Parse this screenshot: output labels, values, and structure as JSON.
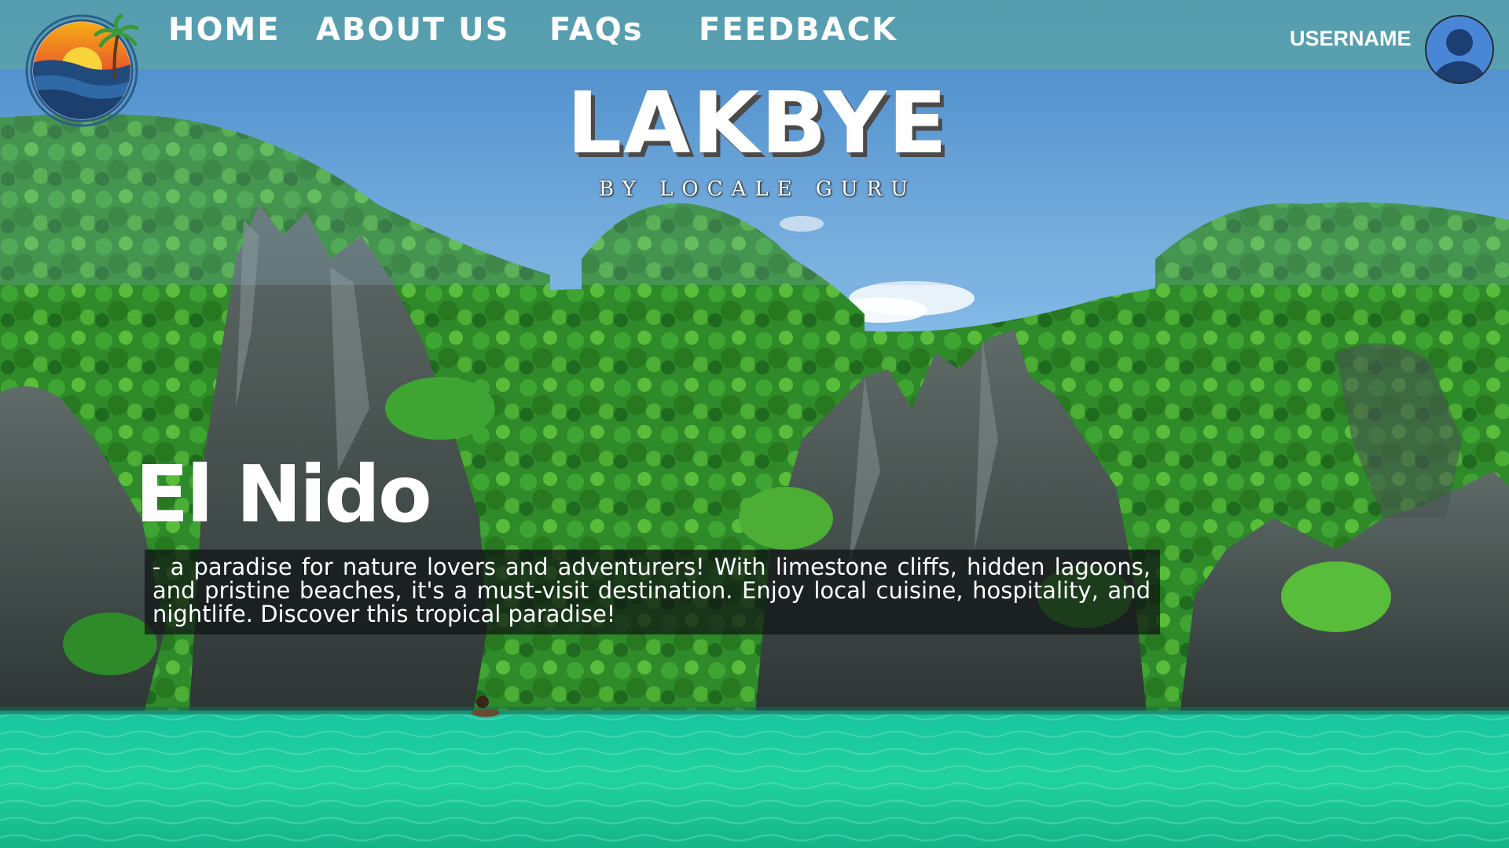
{
  "nav": {
    "items": [
      {
        "label": "HOME"
      },
      {
        "label": "ABOUT US"
      },
      {
        "label": "FAQs"
      },
      {
        "label": "FEEDBACK"
      }
    ]
  },
  "user": {
    "username": "USERNAME",
    "avatar_icon": "user-avatar-icon"
  },
  "brand": {
    "title": "LAKBYE",
    "subtitle": "BY LOCALE GURU",
    "logo_icon": "sunset-island-logo-icon"
  },
  "destination": {
    "name": "El Nido",
    "description": "- a paradise for nature lovers and adventurers! With limestone cliffs, hidden lagoons, and pristine beaches, it's a must-visit destination. Enjoy local cuisine, hospitality, and nightlife. Discover this tropical paradise!"
  },
  "colors": {
    "nav_bar": "#60a8a8",
    "text": "#ffffff",
    "lagoon": "#1fcf9a",
    "avatar": "#4a86d6"
  }
}
